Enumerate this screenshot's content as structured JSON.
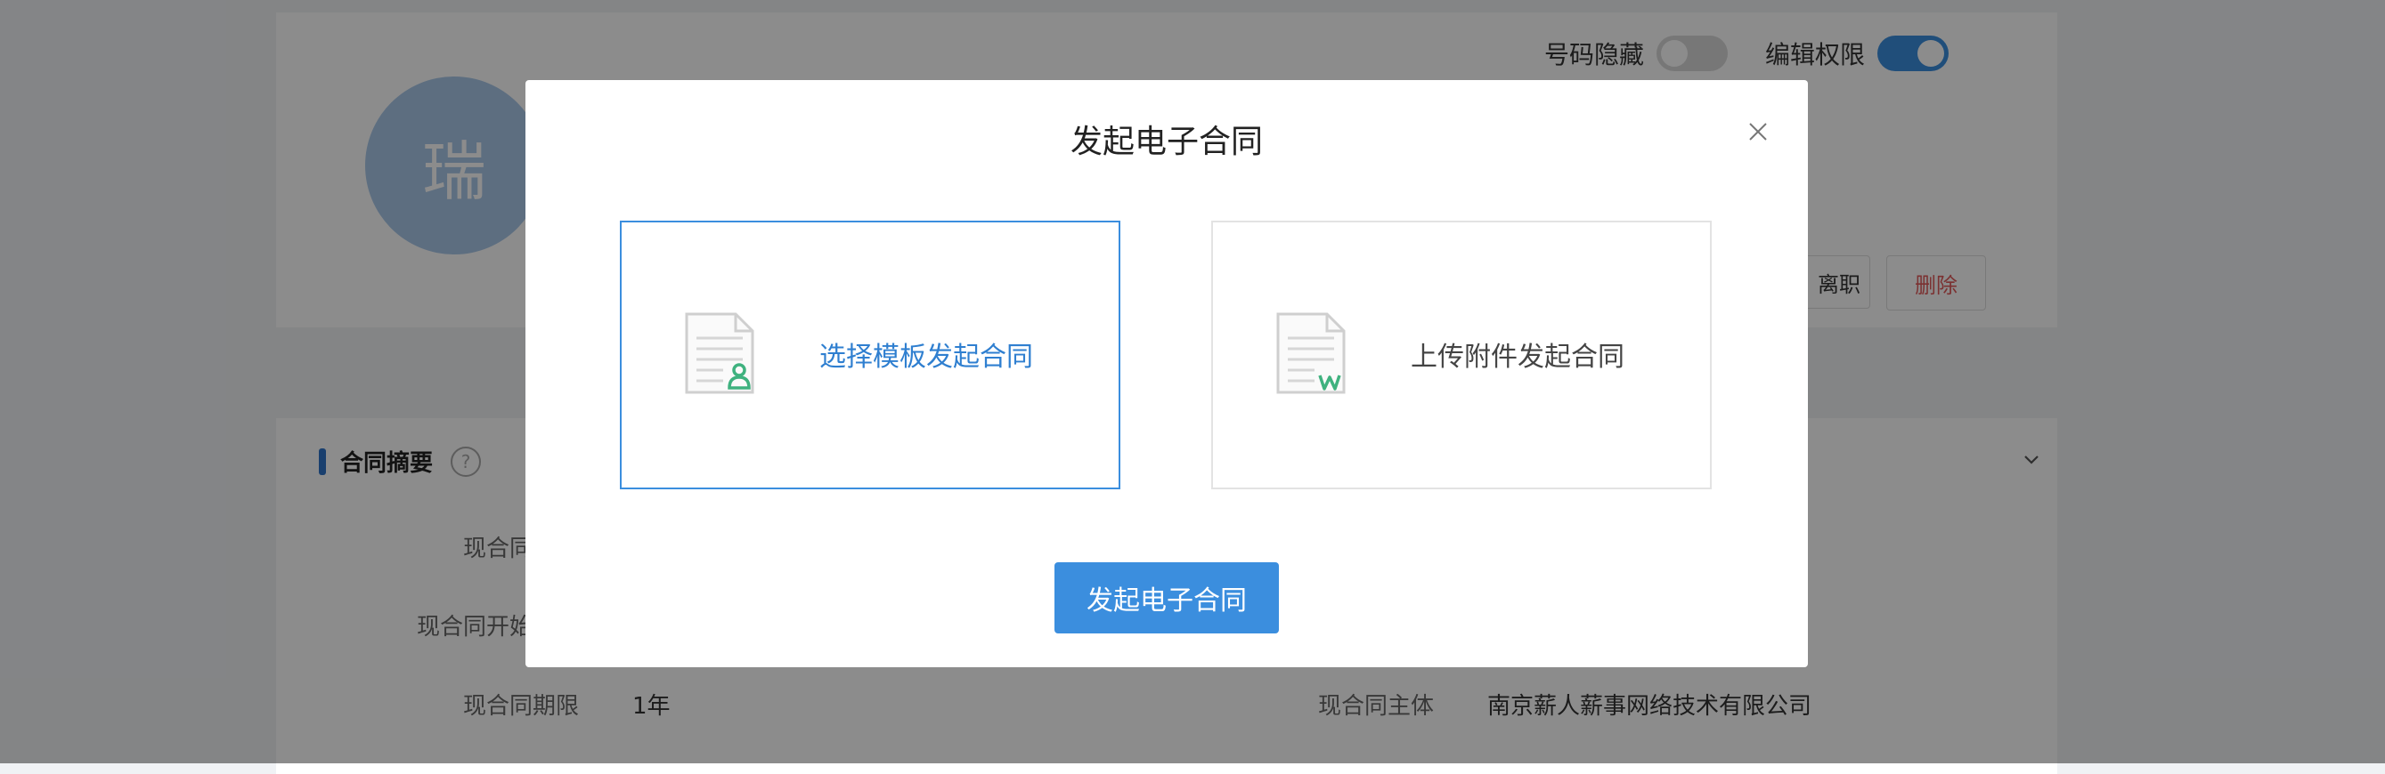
{
  "profile": {
    "avatar_char": "瑞"
  },
  "toggles": [
    {
      "label": "号码隐藏",
      "state": "off"
    },
    {
      "label": "编辑权限",
      "state": "on"
    }
  ],
  "actions": {
    "resign_label": "离职",
    "delete_label": "删除"
  },
  "section": {
    "title": "合同摘要",
    "help": "?"
  },
  "fields": [
    {
      "label": "现合同"
    },
    {
      "label": "现合同开始"
    },
    {
      "label": "现合同期限",
      "value": "1年"
    },
    {
      "label": "现合同主体",
      "value": "南京薪人薪事网络技术有限公司"
    }
  ],
  "modal": {
    "title": "发起电子合同",
    "options": [
      {
        "label": "选择模板发起合同",
        "icon": "template-contract-icon",
        "selected": true
      },
      {
        "label": "上传附件发起合同",
        "icon": "word-document-icon",
        "selected": false
      }
    ],
    "submit_label": "发起电子合同"
  },
  "colors": {
    "accent": "#3b8ede",
    "selected_text": "#2f7fd0",
    "delete_text": "#e05a5a",
    "avatar_bg": "#a9c8ea",
    "icon_green": "#3fb27f"
  }
}
